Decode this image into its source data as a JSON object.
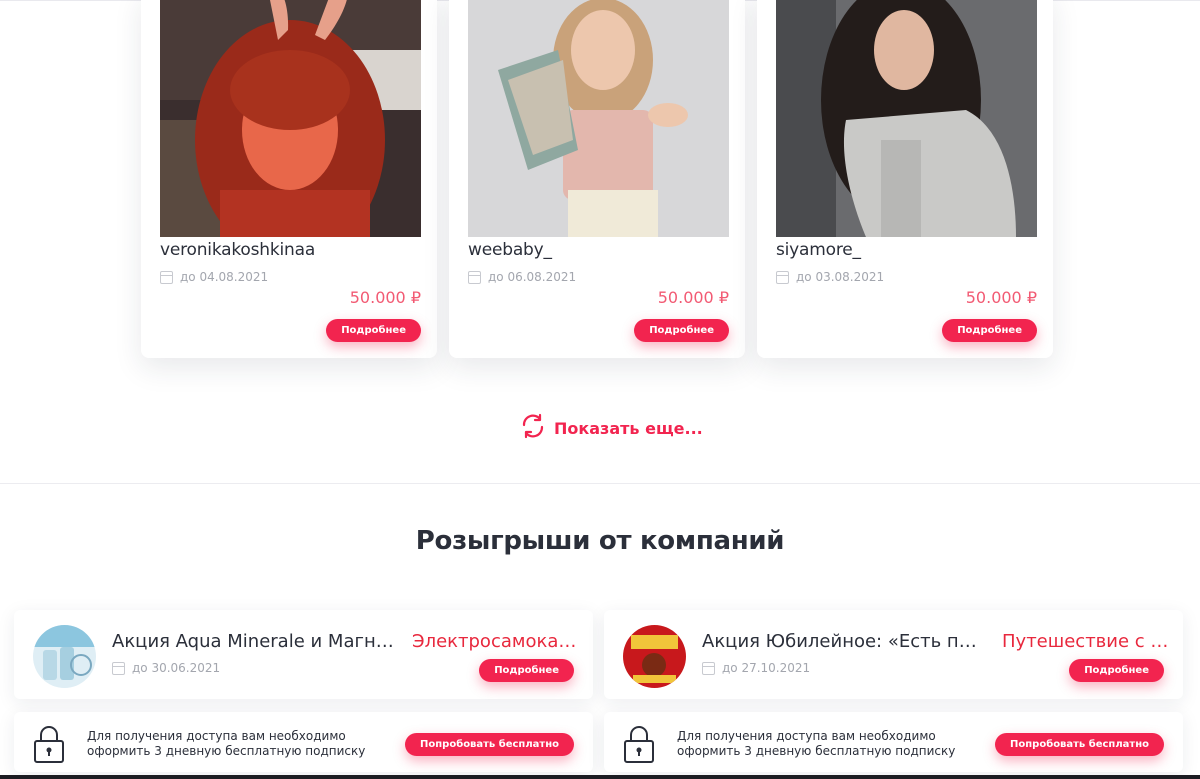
{
  "accent_color": "#f2244f",
  "price_color": "#f25a73",
  "influencers": [
    {
      "name": "veronikakoshkinaa",
      "date": "до 04.08.2021",
      "price": "50.000 ₽",
      "button": "Подробнее"
    },
    {
      "name": "weebaby_",
      "date": "до 06.08.2021",
      "price": "50.000 ₽",
      "button": "Подробнее"
    },
    {
      "name": "siyamore_",
      "date": "до 03.08.2021",
      "price": "50.000 ₽",
      "button": "Подробнее"
    }
  ],
  "show_more": {
    "label": "Показать еще...",
    "icon": "refresh-icon"
  },
  "companies": {
    "title": "Розыгрыши от компаний",
    "items": [
      {
        "title": "Акция Aqua Minerale и Магнит: «Выиграй ...",
        "prize": "Электросамокат, ...",
        "date": "до 30.06.2021",
        "button": "Подробнее",
        "access_text": "Для получения доступа вам необходимо оформить 3 дневную бесплатную подписку",
        "access_button": "Попробовать бесплатно"
      },
      {
        "title": "Акция Юбилейное: «Есть повод собраться»",
        "prize": "Путешествие с близкими",
        "date": "до 27.10.2021",
        "button": "Подробнее",
        "access_text": "Для получения доступа вам необходимо оформить 3 дневную бесплатную подписку",
        "access_button": "Попробовать бесплатно"
      }
    ]
  }
}
